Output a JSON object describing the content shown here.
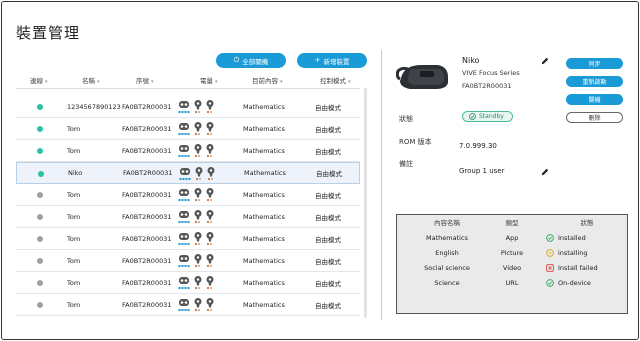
{
  "page": {
    "title": "裝置管理"
  },
  "actions": {
    "shutdown_all": "全部關機",
    "shutdown_icon": "power-icon",
    "add_device": "新增裝置",
    "add_icon": "plus-icon"
  },
  "table": {
    "headers": {
      "status": "連線",
      "name": "名稱",
      "serial": "序號",
      "battery": "電量",
      "content": "目前內容",
      "mode": "控制模式"
    },
    "rows": [
      {
        "online": true,
        "name": "1234567890123",
        "serial": "FA0BT2R00031",
        "content": "Mathematics",
        "mode": "自由模式",
        "selected": false
      },
      {
        "online": true,
        "name": "Tom",
        "serial": "FA0BT2R00031",
        "content": "Mathematics",
        "mode": "自由模式",
        "selected": false
      },
      {
        "online": true,
        "name": "Tom",
        "serial": "FA0BT2R00031",
        "content": "Mathematics",
        "mode": "自由模式",
        "selected": false
      },
      {
        "online": true,
        "name": "Niko",
        "serial": "FA0BT2R00031",
        "content": "Mathematics",
        "mode": "自由模式",
        "selected": true
      },
      {
        "online": false,
        "name": "Tom",
        "serial": "FA0BT2R00031",
        "content": "Mathematics",
        "mode": "自由模式",
        "selected": false
      },
      {
        "online": false,
        "name": "Tom",
        "serial": "FA0BT2R00031",
        "content": "Mathematics",
        "mode": "自由模式",
        "selected": false
      },
      {
        "online": false,
        "name": "Tom",
        "serial": "FA0BT2R00031",
        "content": "Mathematics",
        "mode": "自由模式",
        "selected": false
      },
      {
        "online": false,
        "name": "Tom",
        "serial": "FA0BT2R00031",
        "content": "Mathematics",
        "mode": "自由模式",
        "selected": false
      },
      {
        "online": false,
        "name": "Tom",
        "serial": "FA0BT2R00031",
        "content": "Mathematics",
        "mode": "自由模式",
        "selected": false
      },
      {
        "online": false,
        "name": "Tom",
        "serial": "FA0BT2R00031",
        "content": "Mathematics",
        "mode": "自由模式",
        "selected": false
      }
    ]
  },
  "detail": {
    "device_name": "Niko",
    "model": "VIVE Focus Series",
    "serial": "FA0BT2R00031",
    "buttons": {
      "sync": "同步",
      "restart": "重新啟動",
      "shutdown": "關機",
      "delete": "刪除"
    },
    "status_label": "狀態",
    "status_value": "Standby",
    "rom_label": "ROM 版本",
    "rom_value": "7.0.999.30",
    "note_label": "備註",
    "note_value": "Group 1 user"
  },
  "content_table": {
    "headers": {
      "name": "內容名稱",
      "type": "類型",
      "status": "狀態"
    },
    "rows": [
      {
        "name": "Mathematics",
        "type": "App",
        "status": "Installed",
        "icon": "check-icon"
      },
      {
        "name": "English",
        "type": "Picture",
        "status": "installing",
        "icon": "pending-icon"
      },
      {
        "name": "Social science",
        "type": "Video",
        "status": "Install failed",
        "icon": "error-icon"
      },
      {
        "name": "Science",
        "type": "URL",
        "status": "On-device",
        "icon": "check-icon"
      }
    ]
  },
  "colors": {
    "accent": "#1a9ad6",
    "online": "#2bbfa4",
    "offline": "#a0a0a0",
    "selected_row": "#eef3fb",
    "installed": "#3fae6a",
    "installing": "#e0a82e",
    "failed": "#d9534f"
  }
}
